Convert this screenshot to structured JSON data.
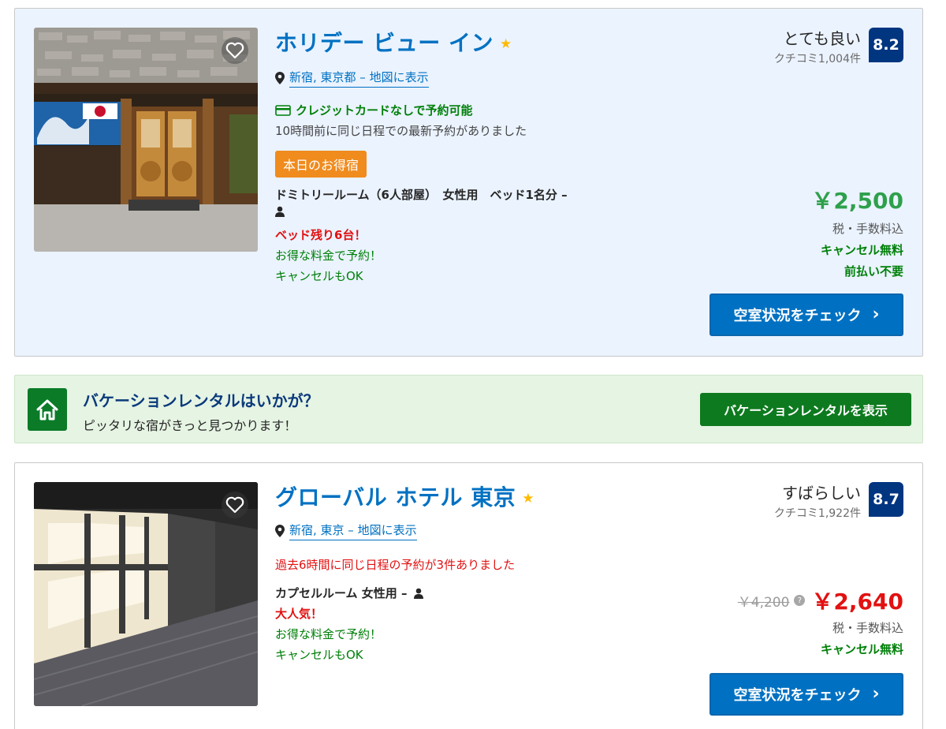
{
  "hotels": [
    {
      "name": "ホリデー ビュー イン",
      "star": "★",
      "location": "新宿, 東京都 – 地図に表示",
      "credit_card": "クレジットカードなしで予約可能",
      "recent_booking": "10時間前に同じ日程での最新予約がありました",
      "deal_badge": "本日のお得宿",
      "room": "ドミトリールーム（6人部屋）　女性用　ベッド1名分 –",
      "scarcity": "ベッド残り6台！",
      "promo1": "お得な料金で予約！",
      "promo2": "キャンセルもOK",
      "review_word": "とても良い",
      "review_count": "クチコミ1,004件",
      "score": "8.2",
      "price": "￥2,500",
      "tax_note": "税・手数料込",
      "free_cancel": "キャンセル無料",
      "no_prepay": "前払い不要",
      "cta": "空室状況をチェック",
      "cta_chevron": "›"
    },
    {
      "name": "グローバル ホテル 東京",
      "star": "★",
      "location": "新宿, 東京 – 地図に表示",
      "recent_booking": "過去6時間に同じ日程の予約が3件ありました",
      "room": "カプセルルーム 女性用 –",
      "popular": "大人気！",
      "promo1": "お得な料金で予約！",
      "promo2": "キャンセルもOK",
      "review_word": "すばらしい",
      "review_count": "クチコミ1,922件",
      "score": "8.7",
      "old_price": "￥4,200",
      "help": "?",
      "price": "￥2,640",
      "tax_note": "税・手数料込",
      "free_cancel": "キャンセル無料",
      "cta": "空室状況をチェック",
      "cta_chevron": "›"
    }
  ],
  "vacation": {
    "title": "バケーションレンタルはいかが？",
    "subtitle": "ピッタリな宿がきっと見つかります！",
    "button": "バケーションレンタルを表示"
  }
}
